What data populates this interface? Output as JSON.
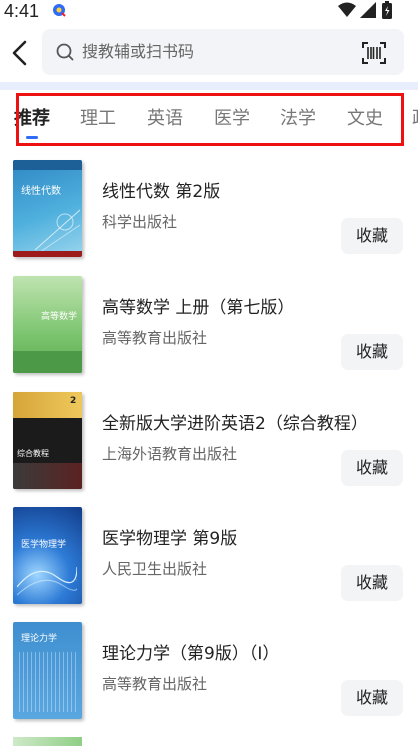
{
  "status": {
    "time": "4:41"
  },
  "search": {
    "placeholder": "搜教辅或扫书码"
  },
  "tabs": [
    {
      "label": "推荐",
      "active": true
    },
    {
      "label": "理工",
      "active": false
    },
    {
      "label": "英语",
      "active": false
    },
    {
      "label": "医学",
      "active": false
    },
    {
      "label": "法学",
      "active": false
    },
    {
      "label": "文史",
      "active": false
    },
    {
      "label": "政",
      "active": false
    }
  ],
  "books": [
    {
      "title": "线性代数 第2版",
      "publisher": "科学出版社",
      "action": "收藏",
      "cover_text": "线性代数"
    },
    {
      "title": "高等数学 上册（第七版）",
      "publisher": "高等教育出版社",
      "action": "收藏",
      "cover_text": "高等数学"
    },
    {
      "title": "全新版大学进阶英语2（综合教程）",
      "publisher": "上海外语教育出版社",
      "action": "收藏",
      "cover_text": "综合教程"
    },
    {
      "title": "医学物理学 第9版",
      "publisher": "人民卫生出版社",
      "action": "收藏",
      "cover_text": "医学物理学"
    },
    {
      "title": "理论力学（第9版）（I）",
      "publisher": "高等教育出版社",
      "action": "收藏",
      "cover_text": "理论力学"
    }
  ],
  "colors": {
    "accent": "#2f6bf7",
    "highlight": "#ee1111",
    "search_bg": "#f3f4f7"
  }
}
